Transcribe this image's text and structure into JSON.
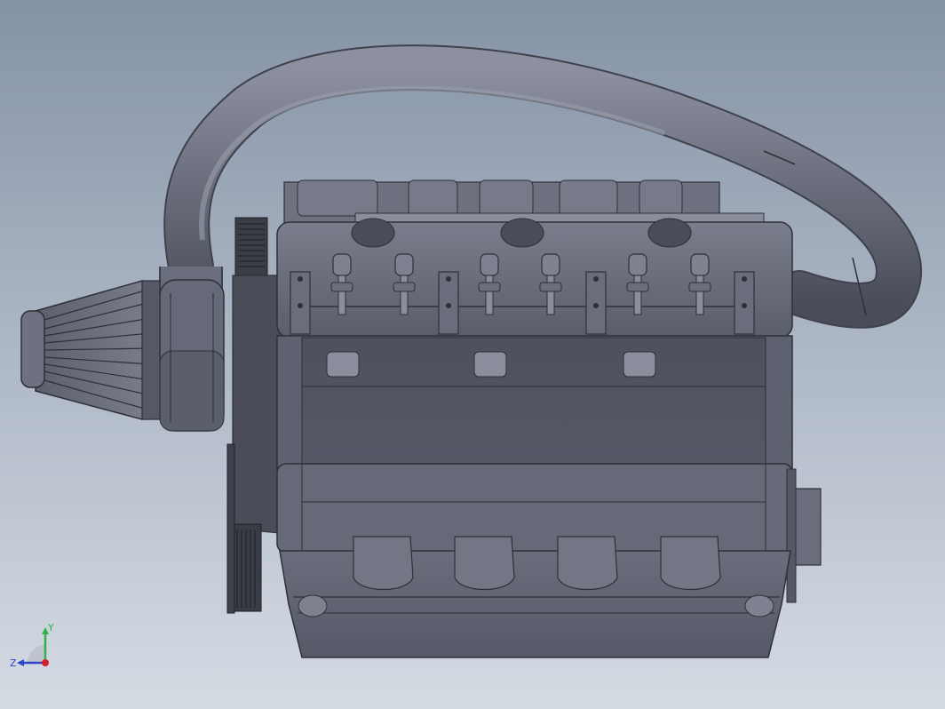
{
  "viewport": {
    "background_top": "#8593a6",
    "background_bottom": "#d5dbe3",
    "model_color": "#5b5e6b"
  },
  "triad": {
    "y_label": "Y",
    "z_label": "Z",
    "y_color": "#2fb24a",
    "z_color": "#2b46c9",
    "x_color": "#d3202a"
  }
}
